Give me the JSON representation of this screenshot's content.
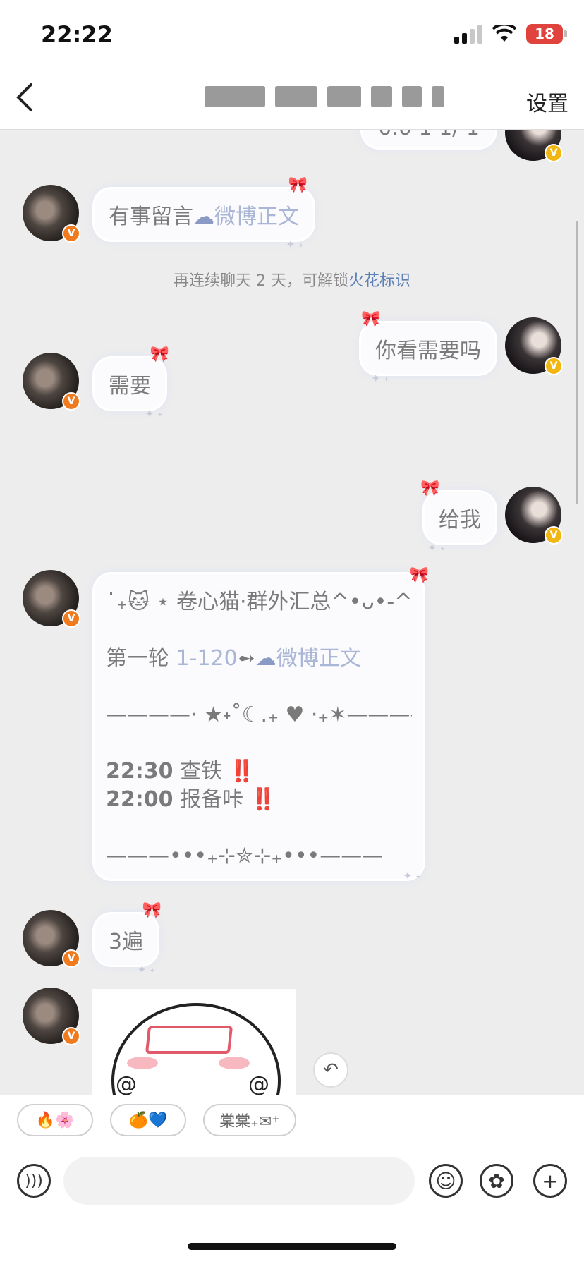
{
  "status_bar": {
    "time": "22:22",
    "battery": "18",
    "signal_icon": "cellular-signal-icon",
    "wifi_icon": "wifi-icon",
    "battery_icon": "battery-low-charging-icon",
    "battery_color": "#e0433d"
  },
  "nav": {
    "back_icon": "chevron-left-icon",
    "settings_label": "设置"
  },
  "messages": {
    "top_partial": "0.0 1 1/ 1",
    "m1_text": "有事留言",
    "m1_link": "微博正文",
    "system_text": "再连续聊天 2 天，可解锁",
    "system_link": "火花标识",
    "m2_text": "你看需要吗",
    "m3_text": "需要",
    "m4_text": "给我",
    "m5_line1": "˙₊🐱 ⋆ 卷心猫·群外汇总^•ᴗ•-^ ٩",
    "m5_line2_prefix": "第一轮 ",
    "m5_line2_range": "1-120",
    "m5_line2_arrow": "➻",
    "m5_line2_link": "微博正文",
    "m5_divider1": "————· ★˖˚☾.₊ ♥︎ ·₊✶————",
    "m5_time1": "22:30",
    "m5_task1": " 查铁 ",
    "m5_time2": "22:00",
    "m5_task2": " 报备咔 ",
    "m5_alert": "‼️",
    "m5_divider2": "———•••₊⊹✮⊹₊•••———",
    "m6_text": "3遍"
  },
  "quick_replies": [
    {
      "label": "🔥🌸"
    },
    {
      "label": "🍊💙"
    },
    {
      "label": "棠棠₊✉︎⁺"
    }
  ],
  "input": {
    "placeholder": "",
    "voice_icon": "voice-icon",
    "emoji_icon": "emoji-icon",
    "sticker_icon": "sticker-icon",
    "add_icon": "plus-icon"
  },
  "colors": {
    "link": "#aab6d6",
    "system_link": "#5c7fb5",
    "left_badge": "#f07a1e",
    "right_badge": "#f2b613"
  }
}
